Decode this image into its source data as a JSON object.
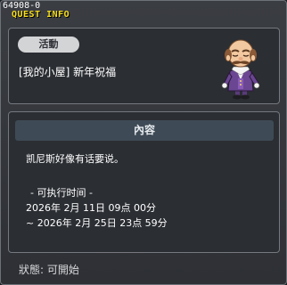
{
  "window": {
    "id_text": "64908-0",
    "title": "QUEST INFO"
  },
  "header": {
    "badge": "活動",
    "quest_name": "[我的小屋] 新年祝福",
    "npc_icon": "npc-old-man-portrait"
  },
  "content": {
    "heading": "內容",
    "lines": [
      "凯尼斯好像有话要说。",
      "- 可执行时间 -",
      "2026年 2月 11日 09点 00分",
      "~ 2026年 2月 25日 23点 59分"
    ]
  },
  "status": {
    "text": "狀態: 可開始"
  },
  "colors": {
    "title_yellow": "#f5dd1b",
    "panel_bg": "#2b2e33",
    "content_header_bg": "#3e4b56",
    "badge_bg": "#d3d4d6"
  }
}
